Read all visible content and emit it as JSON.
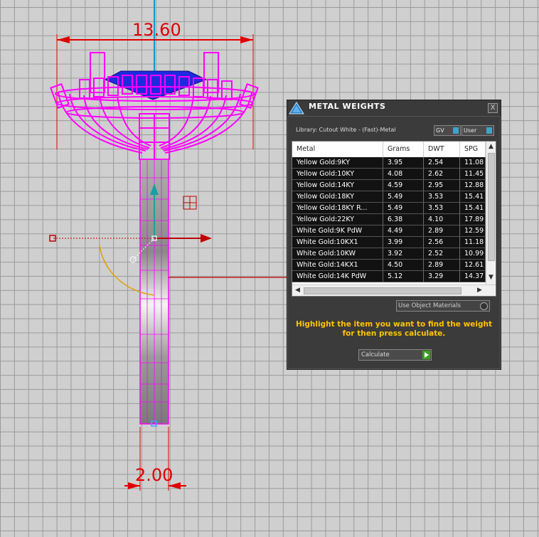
{
  "viewport": {
    "dimension_top": "13.60",
    "dimension_bottom": "2.00"
  },
  "panel": {
    "title": "METAL WEIGHTS",
    "close_label": "X",
    "library_label": "Library: Cutout White - (Fast)-Metal",
    "gv_label": "GV",
    "user_label": "User",
    "columns": [
      "Metal",
      "Grams",
      "DWT",
      "SPG"
    ],
    "rows": [
      [
        "Yellow Gold:9KY",
        "3.95",
        "2.54",
        "11.08"
      ],
      [
        "Yellow Gold:10KY",
        "4.08",
        "2.62",
        "11.45"
      ],
      [
        "Yellow Gold:14KY",
        "4.59",
        "2.95",
        "12.88"
      ],
      [
        "Yellow Gold:18KY",
        "5.49",
        "3.53",
        "15.41"
      ],
      [
        "Yellow Gold:18KY R...",
        "5.49",
        "3.53",
        "15.41"
      ],
      [
        "Yellow Gold:22KY",
        "6.38",
        "4.10",
        "17.89"
      ],
      [
        "White Gold:9K PdW",
        "4.49",
        "2.89",
        "12.59"
      ],
      [
        "White Gold:10KX1",
        "3.99",
        "2.56",
        "11.18"
      ],
      [
        "White Gold:10KW",
        "3.92",
        "2.52",
        "10.99"
      ],
      [
        "White Gold:14KX1",
        "4.50",
        "2.89",
        "12.61"
      ],
      [
        "White Gold:14K PdW",
        "5.12",
        "3.29",
        "14.37"
      ]
    ],
    "use_object_materials_label": "Use Object Materials",
    "hint": "Highlight the item you want to find the weight for then press calculate.",
    "calculate_label": "Calculate"
  },
  "colors": {
    "accent_magenta": "#ff00ff",
    "dimension_red": "#e00000",
    "hint_yellow": "#ffc400",
    "panel_bg": "#3b3b3b"
  }
}
